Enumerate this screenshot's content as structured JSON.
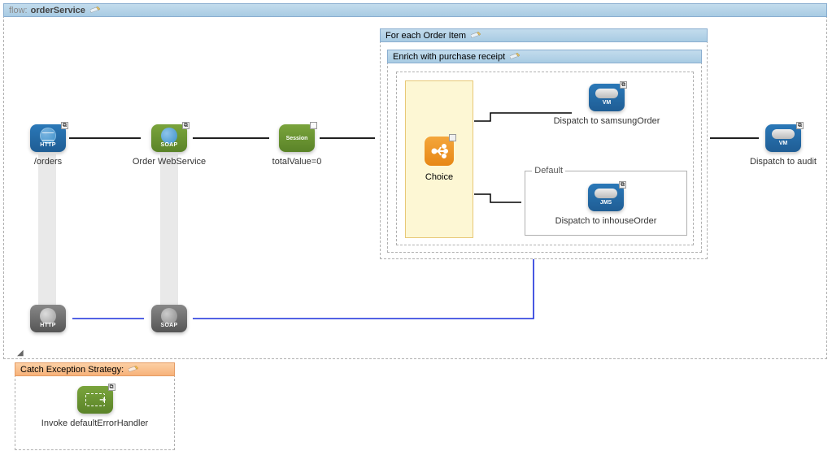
{
  "flow": {
    "label": "flow:",
    "name": "orderService",
    "nodes": {
      "http_in": {
        "type": "HTTP",
        "text": "/orders"
      },
      "soap_in": {
        "type": "SOAP",
        "text": "Order WebService"
      },
      "session": {
        "type": "Session",
        "text": "totalValue=0"
      },
      "audit": {
        "type": "VM",
        "text": "Dispatch to audit"
      },
      "http_out": {
        "type": "HTTP"
      },
      "soap_out": {
        "type": "SOAP"
      }
    },
    "forEach": {
      "title": "For each Order Item",
      "enrich": {
        "title": "Enrich with purchase receipt",
        "choice": {
          "label": "Choice",
          "branches": {
            "samsung": {
              "type": "VM",
              "text": "Dispatch to samsungOrder"
            },
            "default": {
              "label": "Default",
              "type": "JMS",
              "text": "Dispatch to inhouseOrder"
            }
          }
        }
      }
    }
  },
  "exception": {
    "title": "Catch Exception Strategy:",
    "node": {
      "type": "flow-ref",
      "text": "Invoke defaultErrorHandler"
    }
  }
}
